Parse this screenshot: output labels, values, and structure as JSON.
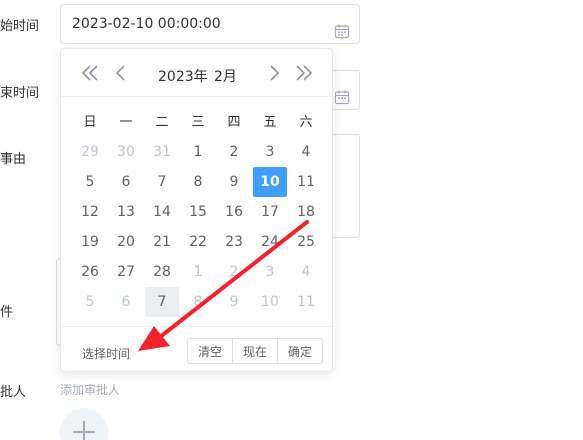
{
  "form": {
    "start_label": "开始时间",
    "end_label": "结束时间",
    "reason_label": "请假事由",
    "attach_label": "附件",
    "approver_label": "审批人",
    "start_value": "2023-02-10 00:00:00",
    "approver_add": "添加审批人"
  },
  "picker": {
    "year": "2023年",
    "month": "2月",
    "weekdays": [
      "日",
      "一",
      "二",
      "三",
      "四",
      "五",
      "六"
    ],
    "days": [
      {
        "n": "29",
        "s": "muted"
      },
      {
        "n": "30",
        "s": "muted"
      },
      {
        "n": "31",
        "s": "muted"
      },
      {
        "n": "1",
        "s": ""
      },
      {
        "n": "2",
        "s": ""
      },
      {
        "n": "3",
        "s": ""
      },
      {
        "n": "4",
        "s": ""
      },
      {
        "n": "5",
        "s": ""
      },
      {
        "n": "6",
        "s": ""
      },
      {
        "n": "7",
        "s": ""
      },
      {
        "n": "8",
        "s": ""
      },
      {
        "n": "9",
        "s": ""
      },
      {
        "n": "10",
        "s": "selected"
      },
      {
        "n": "11",
        "s": ""
      },
      {
        "n": "12",
        "s": ""
      },
      {
        "n": "13",
        "s": ""
      },
      {
        "n": "14",
        "s": ""
      },
      {
        "n": "15",
        "s": ""
      },
      {
        "n": "16",
        "s": ""
      },
      {
        "n": "17",
        "s": ""
      },
      {
        "n": "18",
        "s": ""
      },
      {
        "n": "19",
        "s": ""
      },
      {
        "n": "20",
        "s": ""
      },
      {
        "n": "21",
        "s": ""
      },
      {
        "n": "22",
        "s": ""
      },
      {
        "n": "23",
        "s": ""
      },
      {
        "n": "24",
        "s": ""
      },
      {
        "n": "25",
        "s": ""
      },
      {
        "n": "26",
        "s": ""
      },
      {
        "n": "27",
        "s": ""
      },
      {
        "n": "28",
        "s": ""
      },
      {
        "n": "1",
        "s": "muted"
      },
      {
        "n": "2",
        "s": "muted"
      },
      {
        "n": "3",
        "s": "muted"
      },
      {
        "n": "4",
        "s": "muted"
      },
      {
        "n": "5",
        "s": "muted"
      },
      {
        "n": "6",
        "s": "muted"
      },
      {
        "n": "7",
        "s": "today"
      },
      {
        "n": "8",
        "s": "muted"
      },
      {
        "n": "9",
        "s": "muted"
      },
      {
        "n": "10",
        "s": "muted"
      },
      {
        "n": "11",
        "s": "muted"
      }
    ],
    "select_time": "选择时间",
    "clear": "清空",
    "now": "现在",
    "confirm": "确定"
  },
  "colors": {
    "accent": "#409eff",
    "annotation_arrow": "#f5222d"
  },
  "icons": {
    "prev_year": "double-chevron-left-icon",
    "prev_month": "chevron-left-icon",
    "next_month": "chevron-right-icon",
    "next_year": "double-chevron-right-icon",
    "calendar": "calendar-icon"
  }
}
